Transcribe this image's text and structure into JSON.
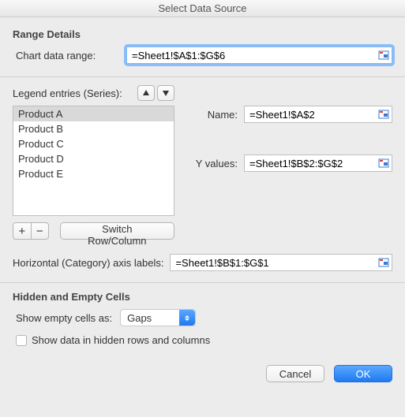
{
  "window_title": "Select Data Source",
  "range_details": {
    "title": "Range Details",
    "chart_data_range_label": "Chart data range:",
    "chart_data_range_value": "=Sheet1!$A$1:$G$6"
  },
  "legend": {
    "label": "Legend entries (Series):",
    "items": [
      "Product A",
      "Product B",
      "Product C",
      "Product D",
      "Product E"
    ],
    "selected_index": 0,
    "switch_label": "Switch Row/Column",
    "name_label": "Name:",
    "name_value": "=Sheet1!$A$2",
    "yvalues_label": "Y values:",
    "yvalues_value": "=Sheet1!$B$2:$G$2"
  },
  "axis": {
    "label": "Horizontal (Category) axis labels:",
    "value": "=Sheet1!$B$1:$G$1"
  },
  "hidden_empty": {
    "title": "Hidden and Empty Cells",
    "show_empty_label": "Show empty cells as:",
    "show_empty_selected": "Gaps",
    "show_hidden_label": "Show data in hidden rows and columns",
    "show_hidden_checked": false
  },
  "buttons": {
    "cancel": "Cancel",
    "ok": "OK"
  }
}
